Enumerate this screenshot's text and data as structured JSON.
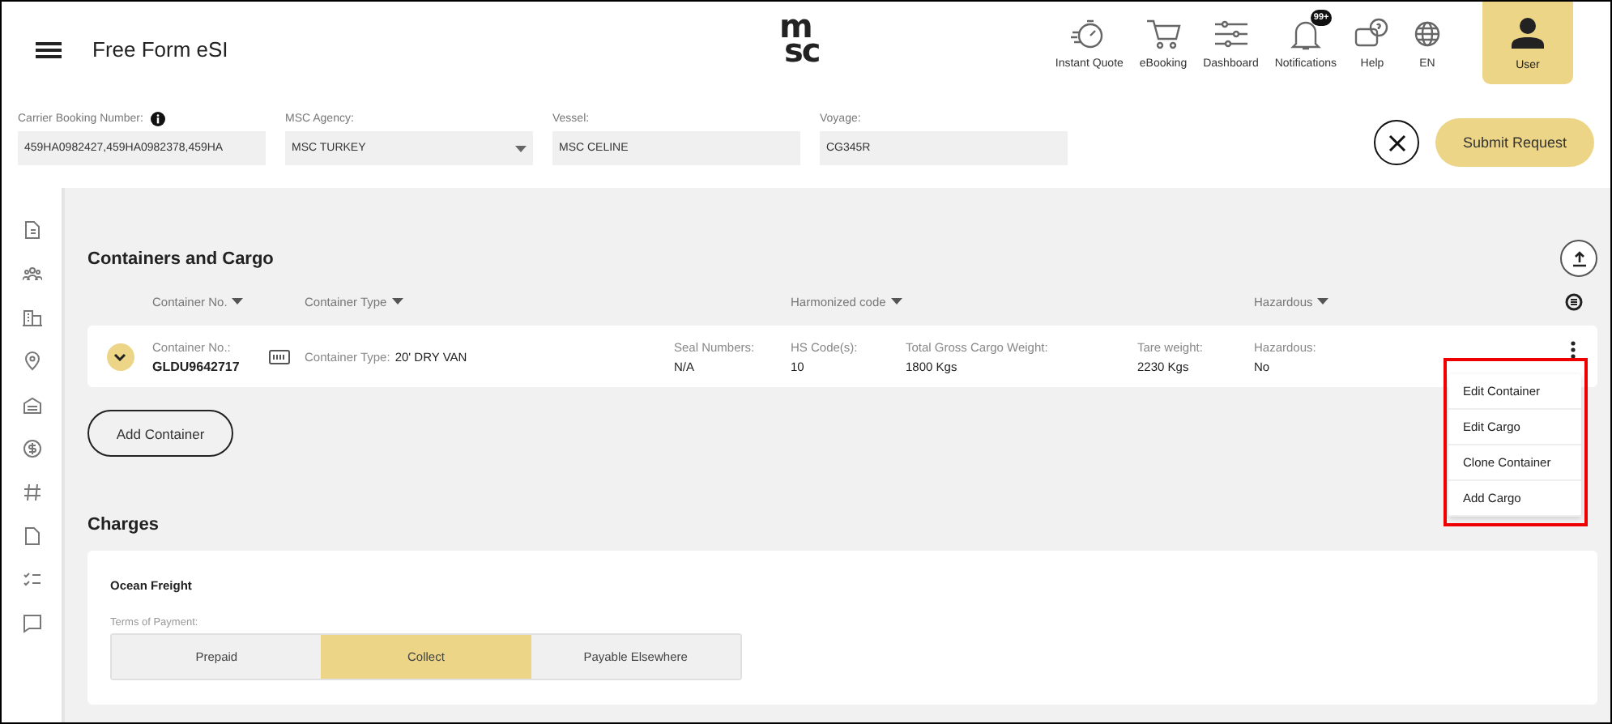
{
  "header": {
    "title": "Free Form eSI",
    "logo": [
      "m",
      "sc"
    ],
    "nav": [
      {
        "label": "Instant Quote"
      },
      {
        "label": "eBooking"
      },
      {
        "label": "Dashboard"
      },
      {
        "label": "Notifications",
        "badge": "99+"
      },
      {
        "label": "Help"
      },
      {
        "label": "EN"
      }
    ],
    "user": {
      "label": "User"
    }
  },
  "form": {
    "fields": [
      {
        "label": "Carrier Booking Number:",
        "value": "459HA0982427,459HA0982378,459HA",
        "kind": "text",
        "info": true
      },
      {
        "label": "MSC Agency:",
        "value": "MSC TURKEY",
        "kind": "select",
        "info": false
      },
      {
        "label": "Vessel:",
        "value": "MSC CELINE",
        "kind": "text",
        "info": false
      },
      {
        "label": "Voyage:",
        "value": "CG345R",
        "kind": "text",
        "info": false
      }
    ],
    "submit": "Submit Request"
  },
  "containers": {
    "title": "Containers and Cargo",
    "columns": [
      {
        "label": "Container No."
      },
      {
        "label": "Container Type"
      },
      {
        "label": "Harmonized code"
      },
      {
        "label": "Hazardous"
      }
    ],
    "rows": [
      {
        "expanded": false,
        "container_no_label": "Container No.:",
        "container_no": "GLDU9642717",
        "type_label": "Container Type:",
        "type": "20' DRY VAN",
        "fields": [
          {
            "label": "Seal Numbers:",
            "value": "N/A"
          },
          {
            "label": "HS Code(s):",
            "value": "10"
          },
          {
            "label": "Total Gross Cargo Weight:",
            "value": "1800 Kgs"
          },
          {
            "label": "Tare weight:",
            "value": "2230 Kgs"
          },
          {
            "label": "Hazardous:",
            "value": "No"
          }
        ]
      }
    ],
    "menu": [
      "Edit Container",
      "Edit Cargo",
      "Clone Container",
      "Add Cargo"
    ],
    "add_button": "Add Container"
  },
  "charges": {
    "title": "Charges",
    "card_title": "Ocean Freight",
    "terms_label": "Terms of Payment:",
    "options": [
      {
        "label": "Prepaid",
        "selected": false
      },
      {
        "label": "Collect",
        "selected": true
      },
      {
        "label": "Payable Elsewhere",
        "selected": false
      }
    ]
  }
}
